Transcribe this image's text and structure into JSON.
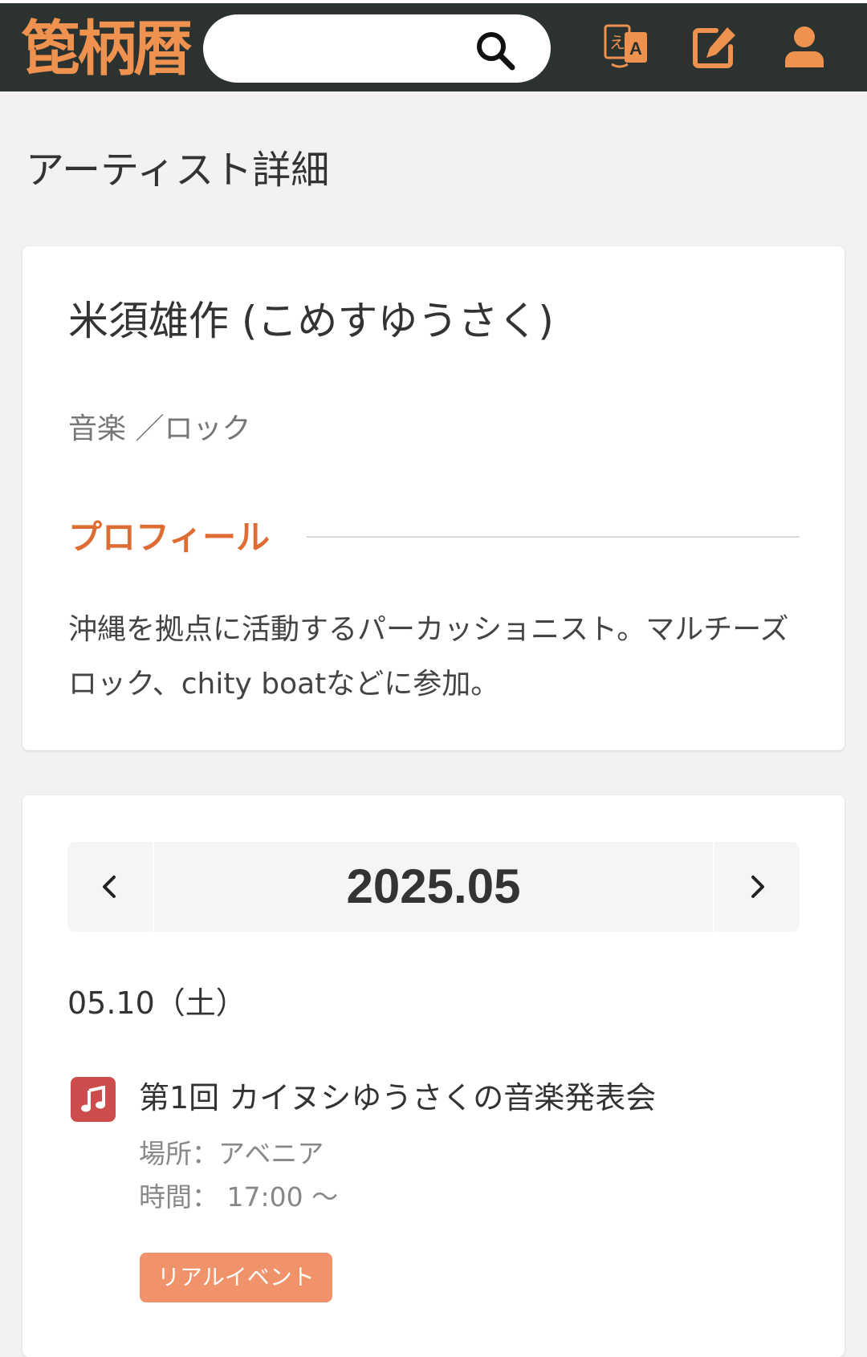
{
  "header": {
    "logo": "箆柄暦",
    "search": {
      "value": "",
      "placeholder": ""
    },
    "icons": [
      "search-icon",
      "translate-icon",
      "edit-icon",
      "user-icon"
    ],
    "colors": {
      "bar": "#2b3230",
      "accent": "#f0924f"
    }
  },
  "page": {
    "title": "アーティスト詳細"
  },
  "artist": {
    "name": "米須雄作 (こめすゆうさく)",
    "genre": "音楽 ／ロック",
    "profile_heading": "プロフィール",
    "profile_text": "沖縄を拠点に活動するパーカッショニスト。マルチーズロック、chity boatなどに参加。"
  },
  "schedule": {
    "month": "2025.05",
    "prev_icon": "chevron-left-icon",
    "next_icon": "chevron-right-icon",
    "events": [
      {
        "date": "05.10（土）",
        "icon": "music-note-icon",
        "title": "第1回 カイヌシゆうさくの音楽発表会",
        "venue": "場所：アベニア",
        "time": "時間： 17:00 〜",
        "tag": "リアルイベント"
      }
    ]
  }
}
